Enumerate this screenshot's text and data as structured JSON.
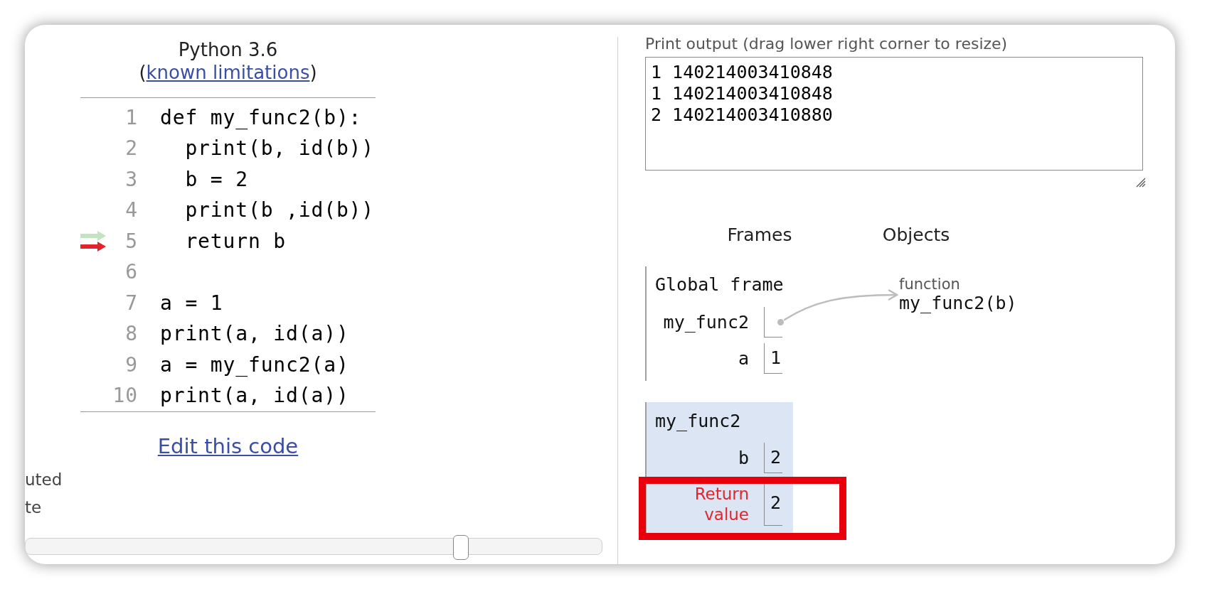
{
  "header": {
    "language": "Python 3.6",
    "note_before": "(",
    "note_link": "known limitations",
    "note_after": ")"
  },
  "code": {
    "lines": [
      {
        "number": "1",
        "text": "def my_func2(b):",
        "just_executed": false,
        "next": false
      },
      {
        "number": "2",
        "text": "  print(b, id(b))",
        "just_executed": false,
        "next": false
      },
      {
        "number": "3",
        "text": "  b = 2",
        "just_executed": false,
        "next": false
      },
      {
        "number": "4",
        "text": "  print(b ,id(b))",
        "just_executed": false,
        "next": false
      },
      {
        "number": "5",
        "text": "  return b",
        "just_executed": true,
        "next": true
      },
      {
        "number": "6",
        "just_executed": false,
        "next": false
      },
      {
        "number": "7",
        "text": "a = 1",
        "just_executed": false,
        "next": false
      },
      {
        "number": "8",
        "text": "print(a, id(a))",
        "just_executed": false,
        "next": false
      },
      {
        "number": "9",
        "text": "a = my_func2(a)",
        "just_executed": false,
        "next": false
      },
      {
        "number": "10",
        "text": "print(a, id(a))",
        "just_executed": false,
        "next": false
      }
    ]
  },
  "edit_link": "Edit this code",
  "legend_fragments": [
    "uted",
    "te"
  ],
  "slider": {
    "level": 0.755
  },
  "print_output": {
    "label": "Print output (drag lower right corner to resize)",
    "lines": [
      "1 140214003410848",
      "1 140214003410848",
      "2 140214003410880"
    ]
  },
  "headings": {
    "frames": "Frames",
    "objects": "Objects"
  },
  "frames": [
    {
      "name": "Global frame",
      "active": false,
      "variables": [
        {
          "name": "my_func2",
          "kind": "pointer",
          "highlighted": false
        },
        {
          "name": "a",
          "kind": "value",
          "value": "1",
          "highlighted": false
        }
      ]
    },
    {
      "name": "my_func2",
      "active": true,
      "variables": [
        {
          "name": "b",
          "kind": "value",
          "value": "2",
          "highlighted": false
        },
        {
          "name": "Return value",
          "kind": "return",
          "value": "2",
          "highlighted": true
        }
      ]
    }
  ],
  "objects": [
    {
      "type_label": "function",
      "value": "my_func2(b)"
    }
  ]
}
